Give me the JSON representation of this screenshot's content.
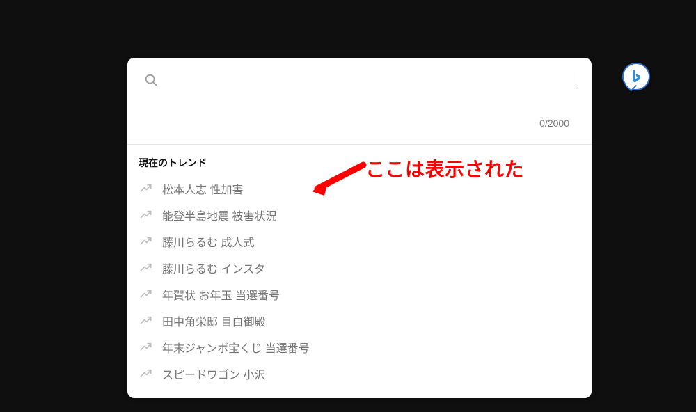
{
  "search": {
    "value": "",
    "placeholder": "",
    "counter": "0/2000"
  },
  "trending": {
    "header": "現在のトレンド",
    "items": [
      {
        "label": "松本人志 性加害"
      },
      {
        "label": "能登半島地震 被害状況"
      },
      {
        "label": "藤川らるむ 成人式"
      },
      {
        "label": "藤川らるむ インスタ"
      },
      {
        "label": "年賀状 お年玉 当選番号"
      },
      {
        "label": "田中角栄邸 目白御殿"
      },
      {
        "label": "年末ジャンボ宝くじ 当選番号"
      },
      {
        "label": "スピードワゴン 小沢"
      }
    ]
  },
  "annotation": {
    "text": "ここは表示された"
  },
  "brand": {
    "name": "Bing"
  }
}
